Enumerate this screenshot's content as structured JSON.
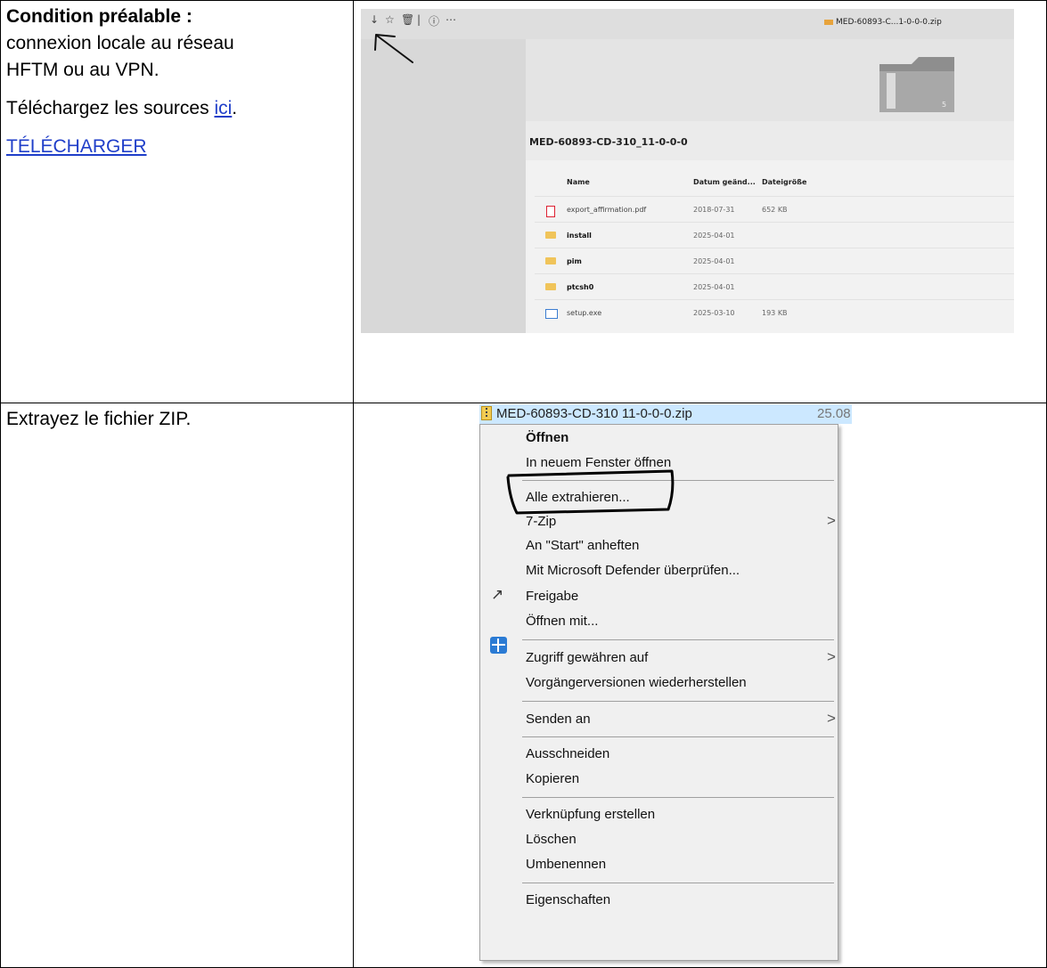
{
  "row1": {
    "heading": "Condition préalable :",
    "line1": "connexion locale au réseau",
    "line2": "HFTM ou au VPN.",
    "download_prefix": "Téléchargez les sources ",
    "download_link": "ici",
    "download_suffix": ".",
    "big_link": "TÉLÉCHARGER"
  },
  "screenshot1": {
    "toolbar_icons": [
      "download-icon",
      "star-icon",
      "trash-icon",
      "separator-icon",
      "info-icon",
      "more-icon"
    ],
    "zip_tab": "MED-60893-C...1-0-0-0.zip",
    "folder_title": "MED-60893-CD-310_11-0-0-0",
    "folder_badge": "5",
    "headers": {
      "name": "Name",
      "date": "Datum geänd...",
      "size": "Dateigröße"
    },
    "files": [
      {
        "name": "export_affirmation.pdf",
        "date": "2018-07-31",
        "size": "652 KB",
        "type": "pdf"
      },
      {
        "name": "install",
        "date": "2025-04-01",
        "size": "",
        "type": "folder"
      },
      {
        "name": "pim",
        "date": "2025-04-01",
        "size": "",
        "type": "folder"
      },
      {
        "name": "ptcsh0",
        "date": "2025-04-01",
        "size": "",
        "type": "folder"
      },
      {
        "name": "setup.exe",
        "date": "2025-03-10",
        "size": "193 KB",
        "type": "exe"
      }
    ]
  },
  "row2": {
    "text": "Extrayez le fichier ZIP."
  },
  "screenshot2": {
    "file_name": "MED-60893-CD-310 11-0-0-0.zip",
    "file_date": "25.08",
    "menu": [
      {
        "label": "Öffnen",
        "bold": true
      },
      {
        "label": "In neuem Fenster öffnen"
      },
      {
        "label": "Alle extrahieren..."
      },
      {
        "label": "7-Zip",
        "submenu": true
      },
      {
        "label": "An \"Start\" anheften"
      },
      {
        "label": "Mit Microsoft Defender überprüfen...",
        "icon": "defender-shield-icon"
      },
      {
        "label": "Freigabe",
        "icon": "share-icon"
      },
      {
        "label": "Öffnen mit..."
      },
      {
        "label": "Zugriff gewähren auf",
        "submenu": true
      },
      {
        "label": "Vorgängerversionen wiederherstellen"
      },
      {
        "label": "Senden an",
        "submenu": true
      },
      {
        "label": "Ausschneiden"
      },
      {
        "label": "Kopieren"
      },
      {
        "label": "Verknüpfung erstellen"
      },
      {
        "label": "Löschen"
      },
      {
        "label": "Umbenennen"
      },
      {
        "label": "Eigenschaften"
      }
    ]
  }
}
